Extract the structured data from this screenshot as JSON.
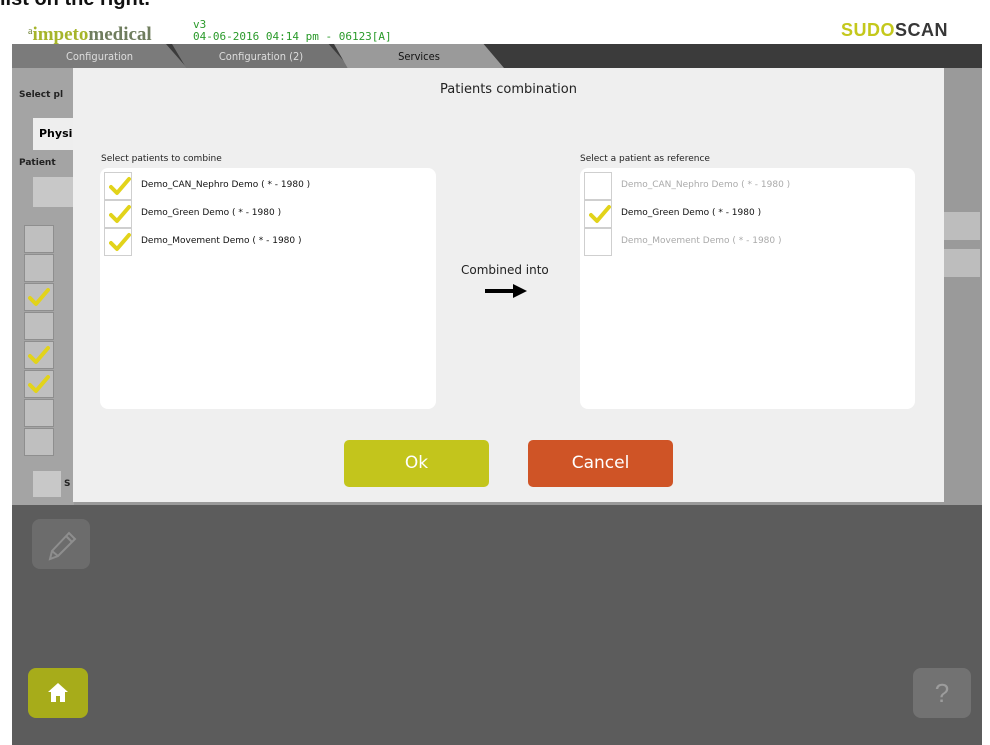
{
  "header": {
    "top_cut_text": "list on the right.",
    "logo_prefix": "a",
    "logo_part1": "impeto",
    "logo_part2": "medical",
    "version": "v3",
    "datetime": "04-06-2016 04:14 pm - 06123[A]",
    "brand_part1": "SUDO",
    "brand_part2": "SCAN"
  },
  "tabs": [
    "Configuration",
    "Configuration (2)",
    "Services"
  ],
  "background": {
    "select_label": "Select pl",
    "phys_button": "Physi",
    "patient_label": "Patient",
    "s_label": "S"
  },
  "modal": {
    "title": "Patients combination",
    "left_title": "Select patients to combine",
    "right_title": "Select a patient as reference",
    "combined_label": "Combined into",
    "left_items": [
      {
        "label": "Demo_CAN_Nephro Demo ( * - 1980 )",
        "checked": true
      },
      {
        "label": "Demo_Green Demo ( * - 1980 )",
        "checked": true
      },
      {
        "label": "Demo_Movement Demo ( * - 1980 )",
        "checked": true
      }
    ],
    "right_items": [
      {
        "label": "Demo_CAN_Nephro Demo ( * - 1980 )",
        "checked": false
      },
      {
        "label": "Demo_Green Demo ( * - 1980 )",
        "checked": true
      },
      {
        "label": "Demo_Movement Demo ( * - 1980 )",
        "checked": false
      }
    ],
    "ok_label": "Ok",
    "cancel_label": "Cancel"
  },
  "footer": {
    "help_label": "?"
  },
  "colors": {
    "accent_yellow": "#c3c51c",
    "cancel_orange": "#cf5426",
    "check_yellow": "#e2d31a"
  },
  "icons": [
    "pencil-icon",
    "home-icon",
    "arrow-right-icon",
    "check-icon"
  ]
}
